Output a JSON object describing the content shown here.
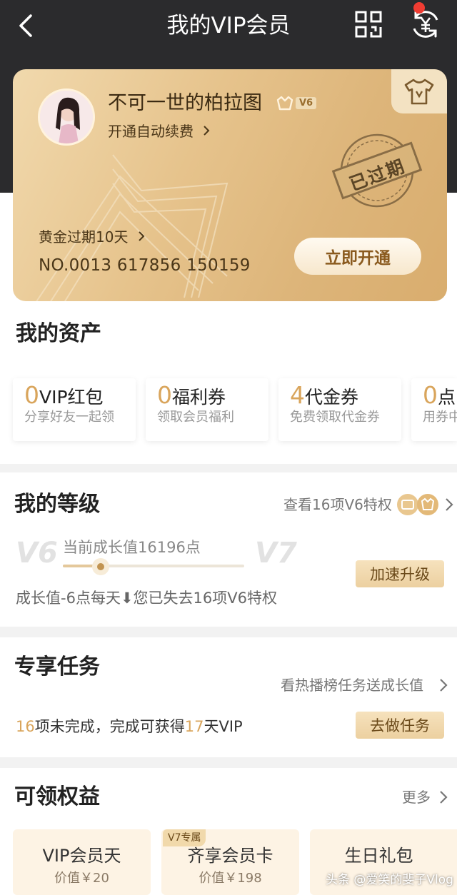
{
  "header": {
    "title": "我的VIP会员"
  },
  "card": {
    "username": "不可一世的柏拉图",
    "level_badge": "V6",
    "auto_renew": "开通自动续费",
    "stamp_text": "已过期",
    "expire_text": "黄金过期10天",
    "card_number": "NO.0013 617856 150159",
    "open_button": "立即开通",
    "colors": {
      "gold": "#e6c38c",
      "dark": "#2b2b2d",
      "red_dot": "#f03c32"
    }
  },
  "assets": {
    "title": "我的资产",
    "items": [
      {
        "num": "0",
        "label": "VIP红包",
        "sub": "分享好友一起领"
      },
      {
        "num": "0",
        "label": "福利券",
        "sub": "领取会员福利"
      },
      {
        "num": "4",
        "label": "代金券",
        "sub": "免费领取代金券"
      },
      {
        "num": "0",
        "label": "点",
        "sub": "用券中"
      }
    ]
  },
  "level": {
    "title": "我的等级",
    "privileges_link": "查看16项V6特权",
    "current_level": "V6",
    "next_level": "V7",
    "growth_text": "当前成长值16196点",
    "progress_fraction": 0.21,
    "boost_button": "加速升级",
    "notice": "成长值-6点每天⬇您已失去16项V6特权"
  },
  "tasks": {
    "title": "专享任务",
    "link": "看热播榜任务送成长值",
    "summary_count": "16",
    "summary_mid": "项未完成，完成可获得",
    "summary_days": "17",
    "summary_end": "天VIP",
    "button": "去做任务"
  },
  "benefits": {
    "title": "可领权益",
    "more": "更多",
    "items": [
      {
        "name": "VIP会员天",
        "value": "价值￥20"
      },
      {
        "name": "齐享会员卡",
        "value": "价值￥198",
        "tag": "V7专属"
      },
      {
        "name": "生日礼包",
        "value": ""
      }
    ]
  },
  "watermark": "头条 @爱笑的斐子Vlog"
}
